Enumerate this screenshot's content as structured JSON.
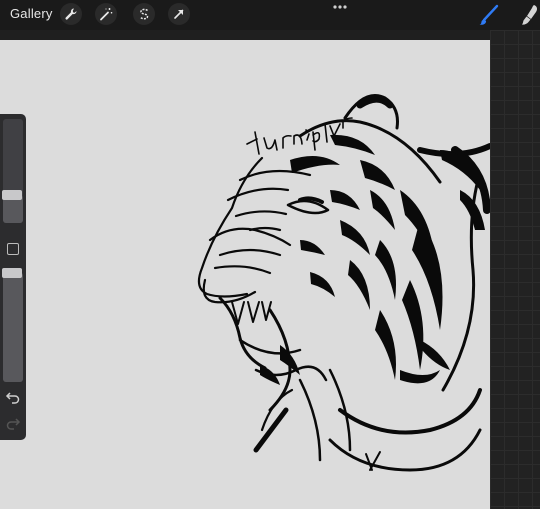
{
  "toolbar": {
    "gallery_label": "Gallery",
    "left_tools": [
      "wrench-icon",
      "magic-wand-icon",
      "selection-icon",
      "transform-arrow-icon"
    ],
    "right_tools": [
      "brush-icon",
      "smudge-icon"
    ],
    "active_tool": "brush",
    "accent": "#2f7bf5"
  },
  "sidebar": {
    "brush_size_level": 0.27,
    "opacity_level": 0.99
  },
  "canvas": {
    "background": "#dcdcdc",
    "signature": "turniplvr",
    "content": "tiger-head-ink-sketch"
  }
}
